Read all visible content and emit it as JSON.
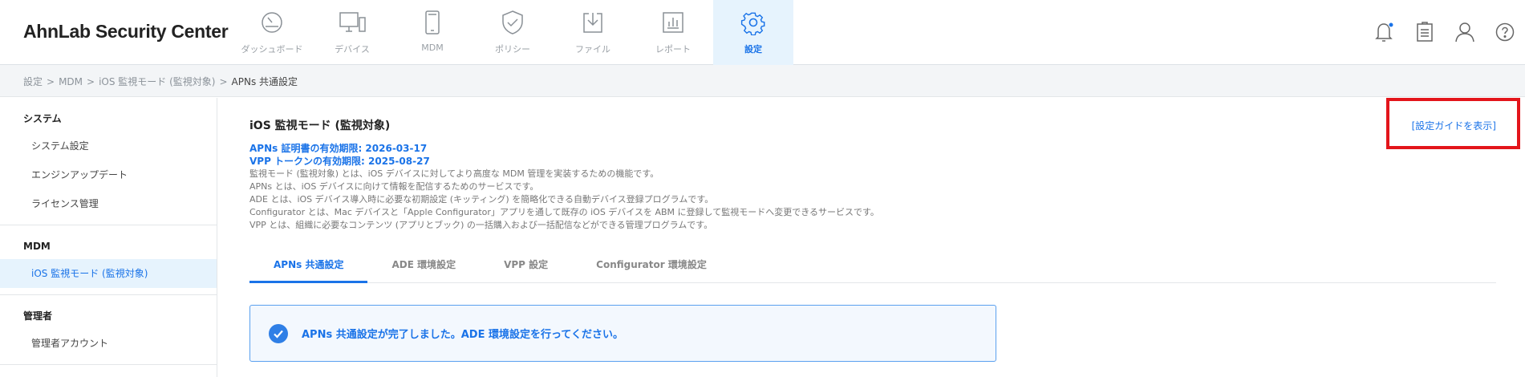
{
  "app": {
    "title": "AhnLab Security Center"
  },
  "nav": [
    {
      "label": "ダッシュボード",
      "icon": "dashboard-gauge-icon",
      "active": false
    },
    {
      "label": "デバイス",
      "icon": "device-monitor-icon",
      "active": false
    },
    {
      "label": "MDM",
      "icon": "mobile-phone-icon",
      "active": false
    },
    {
      "label": "ポリシー",
      "icon": "policy-shield-icon",
      "active": false
    },
    {
      "label": "ファイル",
      "icon": "file-download-icon",
      "active": false
    },
    {
      "label": "レポート",
      "icon": "report-chart-icon",
      "active": false
    },
    {
      "label": "設定",
      "icon": "settings-gear-icon",
      "active": true
    }
  ],
  "header_icons": [
    "notification-bell-icon",
    "clipboard-icon",
    "user-icon",
    "help-icon"
  ],
  "breadcrumb": [
    "設定",
    "MDM",
    "iOS 監視モード (監視対象)",
    "APNs 共通設定"
  ],
  "sidebar": {
    "sections": [
      {
        "title": "システム",
        "items": [
          {
            "label": "システム設定",
            "active": false
          },
          {
            "label": "エンジンアップデート",
            "active": false
          },
          {
            "label": "ライセンス管理",
            "active": false
          }
        ]
      },
      {
        "title": "MDM",
        "items": [
          {
            "label": "iOS 監視モード (監視対象)",
            "active": true
          }
        ]
      },
      {
        "title": "管理者",
        "items": [
          {
            "label": "管理者アカウント",
            "active": false
          }
        ]
      }
    ]
  },
  "main": {
    "title": "iOS 監視モード (監視対象)",
    "guide_link": "[設定ガイドを表示]",
    "apns_expiry": "APNs 証明書の有効期限: 2026-03-17",
    "vpp_expiry": "VPP トークンの有効期限: 2025-08-27",
    "description": [
      "監視モード (監視対象) とは、iOS デバイスに対してより高度な MDM 管理を実装するための機能です。",
      "APNs とは、iOS デバイスに向けて情報を配信するためのサービスです。",
      "ADE とは、iOS デバイス導入時に必要な初期設定 (キッティング) を簡略化できる自動デバイス登録プログラムです。",
      "Configurator とは、Mac デバイスと「Apple Configurator」アプリを通して既存の iOS デバイスを ABM に登録して監視モードへ変更できるサービスです。",
      "VPP とは、組織に必要なコンテンツ (アプリとブック) の一括購入および一括配信などができる管理プログラムです。"
    ],
    "tabs": [
      {
        "label": "APNs 共通設定",
        "active": true
      },
      {
        "label": "ADE 環境設定",
        "active": false
      },
      {
        "label": "VPP 設定",
        "active": false
      },
      {
        "label": "Configurator 環境設定",
        "active": false
      }
    ],
    "banner": {
      "icon": "check-circle-icon",
      "message": "APNs 共通設定が完了しました。ADE 環境設定を行ってください。"
    }
  },
  "colors": {
    "accent": "#1a73e8",
    "active_bg": "#e6f3fd",
    "highlight_box": "#e3151b",
    "muted_text": "#777777"
  }
}
